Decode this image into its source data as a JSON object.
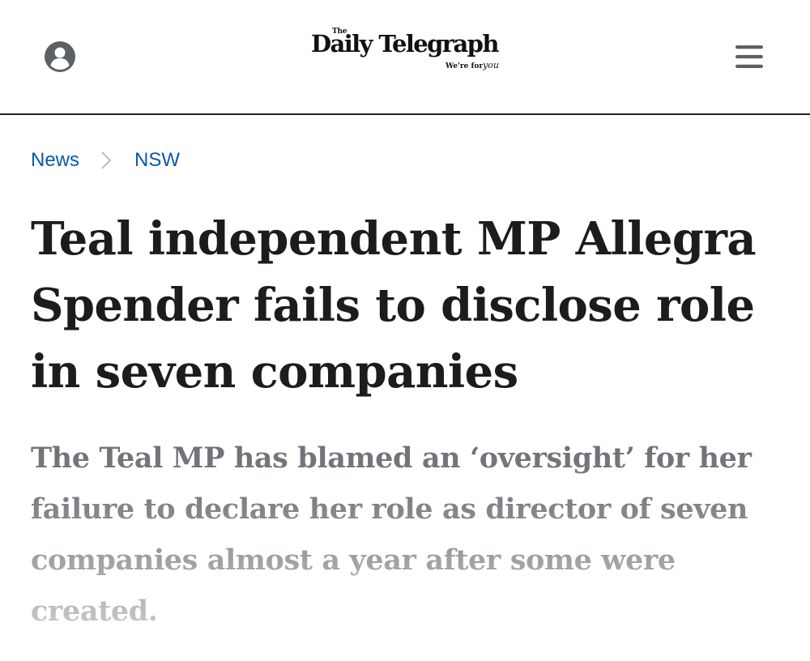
{
  "header": {
    "account_icon": "user-circle-icon",
    "logo": {
      "small_the": "The",
      "name": "Daily Telegraph",
      "tagline_prefix": "We're for",
      "tagline_emphasis": "you"
    },
    "menu_icon": "hamburger-menu-icon"
  },
  "breadcrumb": {
    "items": [
      {
        "label": "News"
      },
      {
        "label": "NSW"
      }
    ],
    "separator_icon": "chevron-right-icon"
  },
  "article": {
    "headline": "Teal independent MP Allegra Spender fails to disclose role in seven companies",
    "standfirst": "The Teal MP has blamed an ‘oversight’ for her failure to declare her role as director of seven companies almost a year after some were created."
  },
  "colors": {
    "link_blue": "#0a5aa8",
    "headline_text": "#1c1c1c",
    "standfirst_text": "#7b7f84",
    "icon_gray": "#5c6166",
    "header_rule": "#222222"
  }
}
